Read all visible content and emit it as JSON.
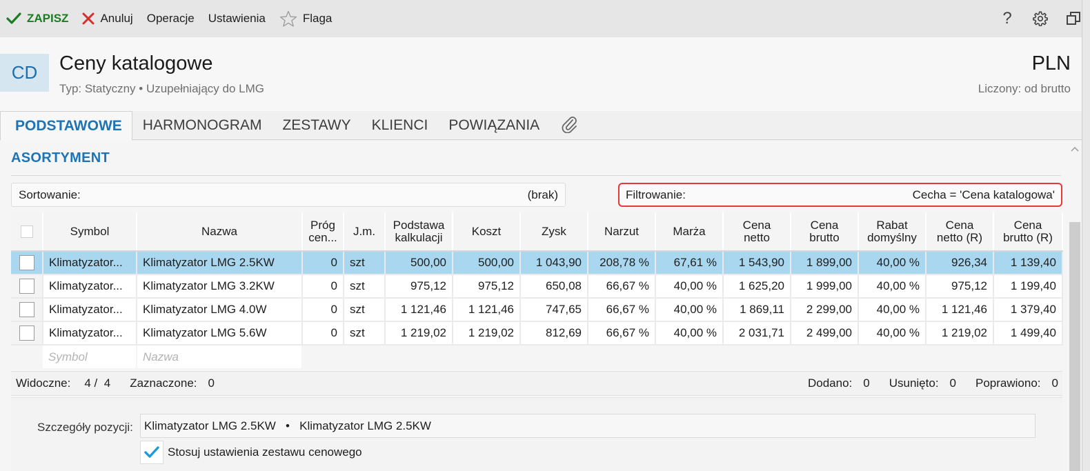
{
  "toolbar": {
    "save_label": "ZAPISZ",
    "cancel_label": "Anuluj",
    "operations_label": "Operacje",
    "settings_label": "Ustawienia",
    "flag_label": "Flaga"
  },
  "header": {
    "avatar_initials": "CD",
    "title": "Ceny katalogowe",
    "subtitle": "Typ: Statyczny • Uzupełniający do LMG",
    "currency": "PLN",
    "calculated": "Liczony: od brutto"
  },
  "tabs": [
    {
      "label": "PODSTAWOWE"
    },
    {
      "label": "HARMONOGRAM"
    },
    {
      "label": "ZESTAWY"
    },
    {
      "label": "KLIENCI"
    },
    {
      "label": "POWIĄZANIA"
    }
  ],
  "section": {
    "title": "ASORTYMENT"
  },
  "sorting": {
    "label": "Sortowanie:",
    "value": "(brak)"
  },
  "filtering": {
    "label": "Filtrowanie:",
    "value": "Cecha = 'Cena katalogowa'"
  },
  "grid": {
    "headers": {
      "symbol": "Symbol",
      "name": "Nazwa",
      "threshold_1": "Próg",
      "threshold_2": "cen...",
      "unit": "J.m.",
      "base_1": "Podstawa",
      "base_2": "kalkulacji",
      "cost": "Koszt",
      "profit": "Zysk",
      "markup": "Narzut",
      "margin": "Marża",
      "net_1": "Cena",
      "net_2": "netto",
      "gross_1": "Cena",
      "gross_2": "brutto",
      "discount_1": "Rabat",
      "discount_2": "domyślny",
      "netr_1": "Cena",
      "netr_2": "netto (R)",
      "grossr_1": "Cena",
      "grossr_2": "brutto (R)"
    },
    "rows": [
      {
        "symbol": "Klimatyzator...",
        "name": "Klimatyzator LMG 2.5KW",
        "threshold": "0",
        "unit": "szt",
        "base": "500,00",
        "cost": "500,00",
        "profit": "1 043,90",
        "markup": "208,78 %",
        "margin": "67,61 %",
        "net": "1 543,90",
        "gross": "1 899,00",
        "discount": "40,00 %",
        "net_r": "926,34",
        "gross_r": "1 139,40"
      },
      {
        "symbol": "Klimatyzator...",
        "name": "Klimatyzator LMG 3.2KW",
        "threshold": "0",
        "unit": "szt",
        "base": "975,12",
        "cost": "975,12",
        "profit": "650,08",
        "markup": "66,67 %",
        "margin": "40,00 %",
        "net": "1 625,20",
        "gross": "1 999,00",
        "discount": "40,00 %",
        "net_r": "975,12",
        "gross_r": "1 199,40"
      },
      {
        "symbol": "Klimatyzator...",
        "name": "Klimatyzator LMG 4.0W",
        "threshold": "0",
        "unit": "szt",
        "base": "1 121,46",
        "cost": "1 121,46",
        "profit": "747,65",
        "markup": "66,67 %",
        "margin": "40,00 %",
        "net": "1 869,11",
        "gross": "2 299,00",
        "discount": "40,00 %",
        "net_r": "1 121,46",
        "gross_r": "1 379,40"
      },
      {
        "symbol": "Klimatyzator...",
        "name": "Klimatyzator LMG 5.6W",
        "threshold": "0",
        "unit": "szt",
        "base": "1 219,02",
        "cost": "1 219,02",
        "profit": "812,69",
        "markup": "66,67 %",
        "margin": "40,00 %",
        "net": "2 031,71",
        "gross": "2 499,00",
        "discount": "40,00 %",
        "net_r": "1 219,02",
        "gross_r": "1 499,40"
      }
    ],
    "filter_placeholders": {
      "symbol": "Symbol",
      "name": "Nazwa"
    }
  },
  "status": {
    "visible_label": "Widoczne:",
    "visible_value": "4 /  4",
    "selected_label": "Zaznaczone:",
    "selected_value": "0",
    "added_label": "Dodano:",
    "added_value": "0",
    "removed_label": "Usunięto:",
    "removed_value": "0",
    "corrected_label": "Poprawiono:",
    "corrected_value": "0"
  },
  "details": {
    "label": "Szczegóły pozycji:",
    "value": "Klimatyzator LMG 2.5KW   •   Klimatyzator LMG 2.5KW",
    "checkbox_label": "Stosuj ustawienia zestawu cenowego"
  },
  "colors": {
    "accent": "#1e73b4",
    "save_green": "#1c7c22",
    "cancel_red": "#d32f2f",
    "selected_row": "#a9d7ef",
    "filter_border": "#e53935",
    "checkmark": "#1e9bd7"
  }
}
